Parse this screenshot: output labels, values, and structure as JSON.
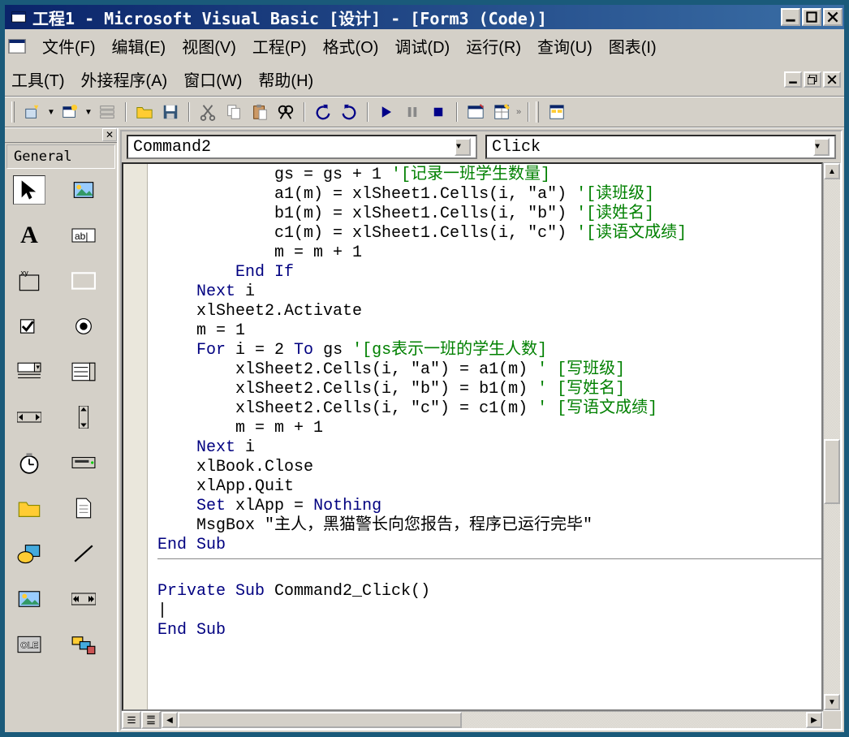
{
  "title": "工程1 - Microsoft Visual Basic [设计] - [Form3 (Code)]",
  "menu": {
    "file": "文件(F)",
    "edit": "编辑(E)",
    "view": "视图(V)",
    "project": "工程(P)",
    "format": "格式(O)",
    "debug": "调试(D)",
    "run": "运行(R)",
    "query": "查询(U)",
    "diagram": "图表(I)",
    "tools": "工具(T)",
    "addins": "外接程序(A)",
    "window": "窗口(W)",
    "help": "帮助(H)"
  },
  "toolbox": {
    "title": "General"
  },
  "combos": {
    "object": "Command2",
    "proc": "Click"
  },
  "code": {
    "l1a": "            gs = gs + 1 ",
    "l1c": "'[记录一班学生数量]",
    "l2a": "            a1(m) = xlSheet1.Cells(i, \"a\") ",
    "l2c": "'[读班级]",
    "l3a": "            b1(m) = xlSheet1.Cells(i, \"b\") ",
    "l3c": "'[读姓名]",
    "l4a": "            c1(m) = xlSheet1.Cells(i, \"c\") ",
    "l4c": "'[读语文成绩]",
    "l5": "            m = m + 1",
    "l6a": "        ",
    "l6k": "End If",
    "l7a": "    ",
    "l7k": "Next",
    "l7b": " i",
    "l8": "    xlSheet2.Activate",
    "l9": "    m = 1",
    "l10a": "    ",
    "l10k": "For",
    "l10b": " i = 2 ",
    "l10k2": "To",
    "l10c": " gs ",
    "l10cm": "'[gs表示一班的学生人数]",
    "l11a": "        xlSheet2.Cells(i, \"a\") = a1(m) ",
    "l11c": "' [写班级]",
    "l12a": "        xlSheet2.Cells(i, \"b\") = b1(m) ",
    "l12c": "' [写姓名]",
    "l13a": "        xlSheet2.Cells(i, \"c\") = c1(m) ",
    "l13c": "' [写语文成绩]",
    "l14": "        m = m + 1",
    "l15a": "    ",
    "l15k": "Next",
    "l15b": " i",
    "l16": "    xlBook.Close",
    "l17": "    xlApp.Quit",
    "l18a": "    ",
    "l18k": "Set",
    "l18b": " xlApp = ",
    "l18k2": "Nothing",
    "l19": "    MsgBox \"主人，黑猫警长向您报告，程序已运行完毕\"",
    "l20k": "End Sub",
    "l21a": "Private Sub",
    "l21b": " Command2_Click()",
    "l22": "|",
    "l23k": "End Sub"
  }
}
